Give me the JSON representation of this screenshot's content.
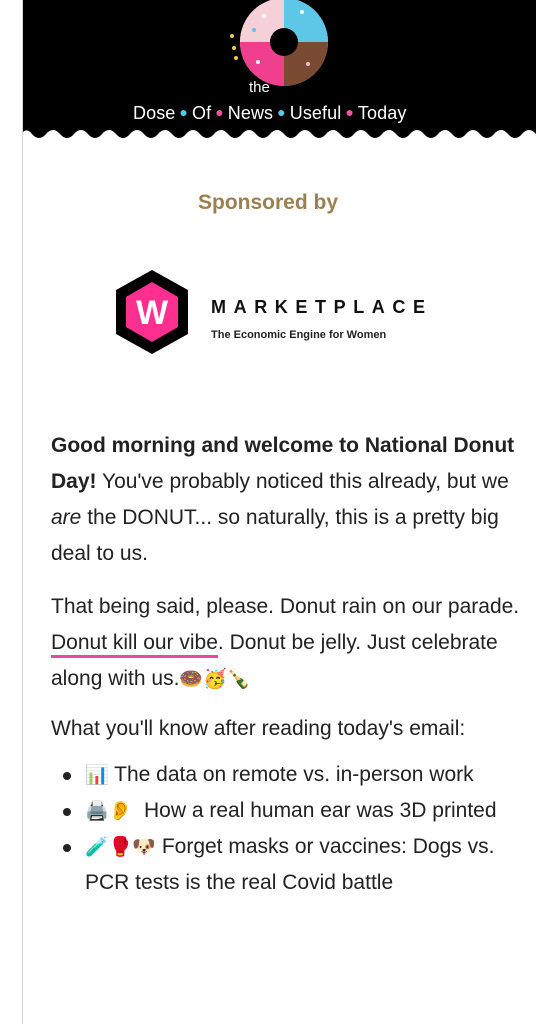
{
  "header": {
    "brand_the": "the",
    "brand_words": [
      "Dose",
      "Of",
      "News",
      "Useful",
      "Today"
    ],
    "colors": {
      "background": "#000000",
      "accent_blue": "#58c8ea",
      "accent_pink": "#f0559b"
    },
    "logo_icon": "donut-icon"
  },
  "sponsor": {
    "label": "Sponsored by",
    "logo_letter": "W",
    "name": "MARKETPLACE",
    "tagline": "The Economic Engine for Women",
    "color": "#ff2f8f"
  },
  "body": {
    "intro_bold": "Good morning and welcome to National Donut Day!",
    "intro_rest_1": " You've probably noticed this already, but we ",
    "intro_italic": "are",
    "intro_rest_2": " the DONUT... so naturally, this is a pretty big deal to us.",
    "p2_a": "That being said, please. Donut rain on our parade. ",
    "p2_link": "Donut kill our vibe",
    "p2_b": ". Donut be jelly. Just celebrate along with us.",
    "p2_emojis": "🍩🥳🍾",
    "p3": "What you'll know after reading today's email:"
  },
  "bullets": [
    {
      "emoji": "📊",
      "text": "The data on remote vs. in-person work"
    },
    {
      "emoji": "🖨️👂",
      "text": "How a real human ear was 3D printed"
    },
    {
      "emoji": "🧪🥊🐶",
      "text": "Forget masks or vaccines: Dogs vs. PCR tests is the real Covid battle"
    }
  ]
}
